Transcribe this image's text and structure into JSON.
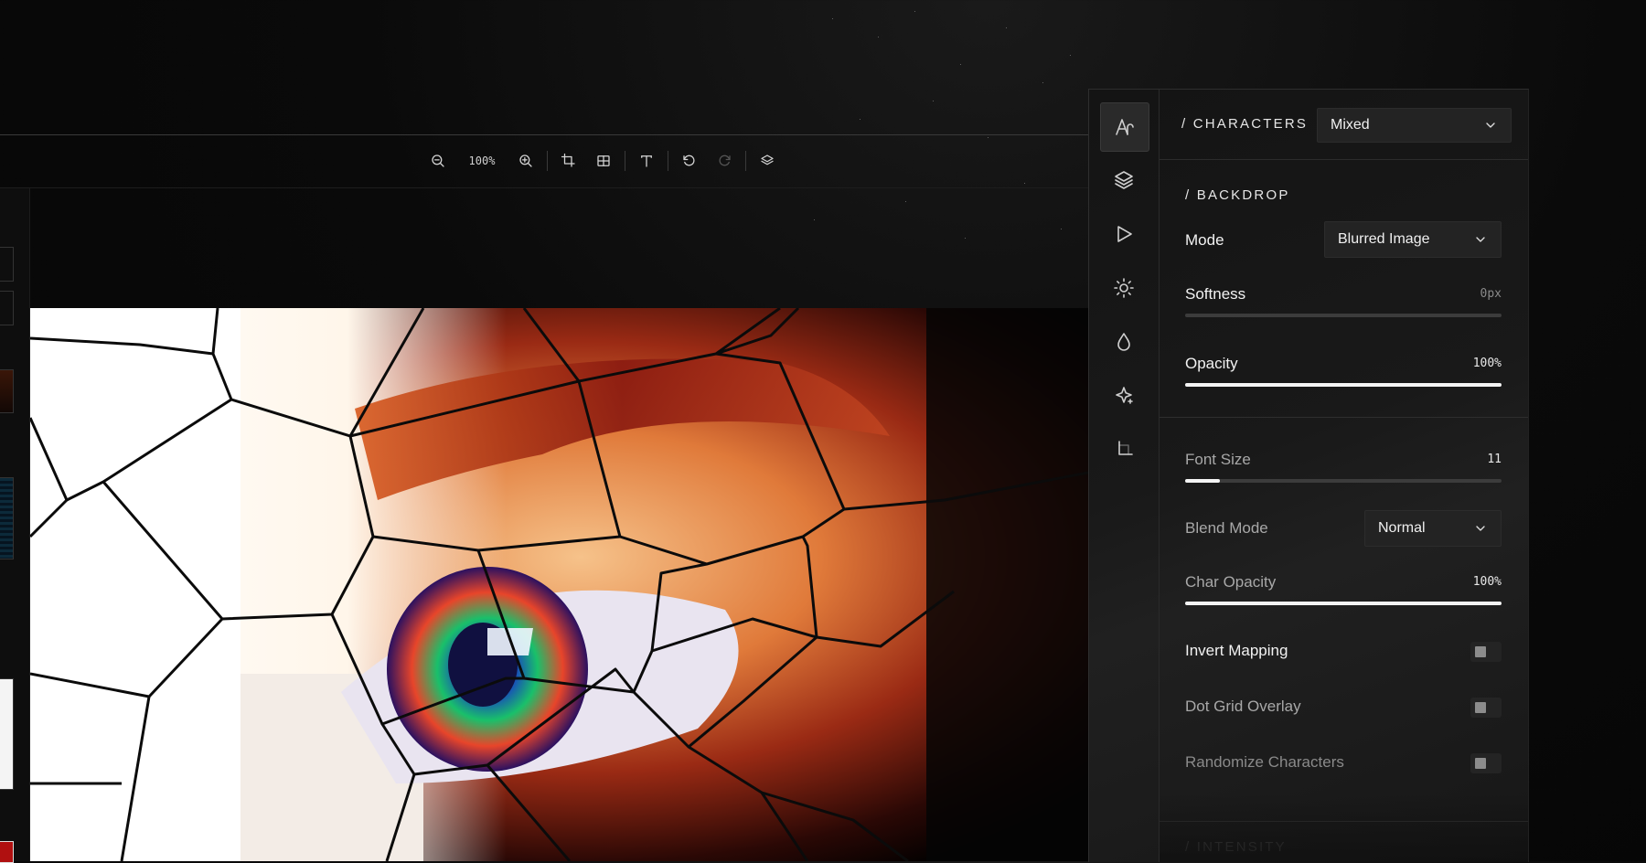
{
  "toolbar": {
    "zoom_level": "100%",
    "buttons": [
      "zoom-out-icon",
      "zoom-in-icon",
      "crop-icon",
      "split-view-icon",
      "text-tool-icon",
      "undo-icon",
      "redo-icon",
      "layers-icon"
    ]
  },
  "rail": {
    "items": [
      {
        "icon": "characters-icon",
        "active": true
      },
      {
        "icon": "layers-icon",
        "active": false
      },
      {
        "icon": "play-icon",
        "active": false
      },
      {
        "icon": "brightness-icon",
        "active": false
      },
      {
        "icon": "droplet-icon",
        "active": false
      },
      {
        "icon": "sparkle-icon",
        "active": false
      },
      {
        "icon": "crop-icon",
        "active": false
      }
    ]
  },
  "characters": {
    "title": "/ CHARACTERS",
    "select_value": "Mixed"
  },
  "backdrop": {
    "title": "/ BACKDROP",
    "mode_label": "Mode",
    "mode_value": "Blurred Image",
    "softness_label": "Softness",
    "softness_value": "0px",
    "softness_fraction": 0,
    "opacity_label": "Opacity",
    "opacity_value": "100%",
    "opacity_fraction": 1
  },
  "settings": {
    "font_size_label": "Font Size",
    "font_size_value": "11",
    "font_size_fraction": 0.11,
    "blend_mode_label": "Blend Mode",
    "blend_mode_value": "Normal",
    "char_opacity_label": "Char Opacity",
    "char_opacity_value": "100%",
    "char_opacity_fraction": 1,
    "invert_mapping_label": "Invert Mapping",
    "dot_grid_label": "Dot Grid Overlay",
    "randomize_label": "Randomize Characters"
  },
  "intensity": {
    "title": "/ INTENSITY"
  },
  "colors": {
    "accent": "#f4f4f4",
    "panel_bg": "#191919",
    "background": "#050505"
  }
}
